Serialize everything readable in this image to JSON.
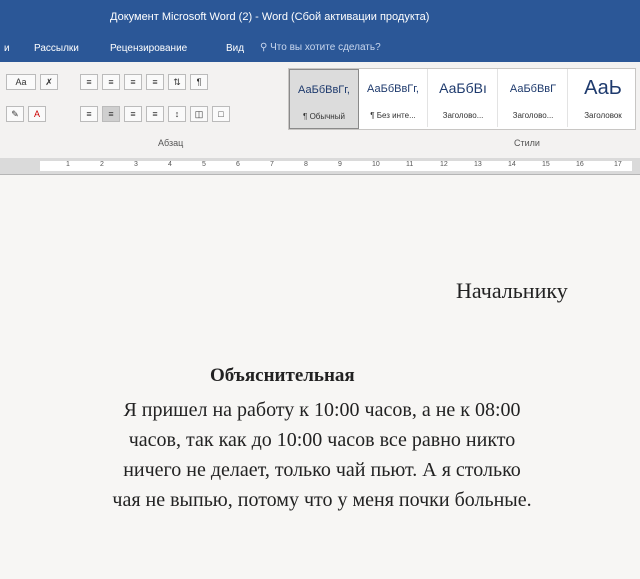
{
  "window": {
    "title": "Документ Microsoft Word (2) - Word (Сбой активации продукта)"
  },
  "ribbon_tabs": [
    "и",
    "Рассылки",
    "Рецензирование",
    "Вид"
  ],
  "tell_me": "Что вы хотите сделать?",
  "font_group": {
    "size_label": "Аа"
  },
  "paragraph_group": {
    "label": "Абзац"
  },
  "styles_group": {
    "label": "Стили",
    "items": [
      {
        "sample": "АаБбВвГг,",
        "name": "¶ Обычный"
      },
      {
        "sample": "АаБбВвГг,",
        "name": "¶ Без инте..."
      },
      {
        "sample": "АаБбВı",
        "name": "Заголово..."
      },
      {
        "sample": "АаБбВвГ",
        "name": "Заголово..."
      },
      {
        "sample": "АаЬ",
        "name": "Заголовок"
      }
    ]
  },
  "ruler": {
    "numbers": [
      "1",
      "2",
      "3",
      "4",
      "5",
      "6",
      "7",
      "8",
      "9",
      "10",
      "11",
      "12",
      "13",
      "14",
      "15",
      "16",
      "17"
    ]
  },
  "document": {
    "addressee": "Начальнику",
    "title": "Объяснительная",
    "lines": [
      "Я пришел на работу к 10:00 часов, а не к 08:00",
      "часов, так как до 10:00 часов все равно никто",
      "ничего не делает, только чай пьют. А я столько",
      "чая не выпью, потому что у меня почки больные."
    ]
  }
}
